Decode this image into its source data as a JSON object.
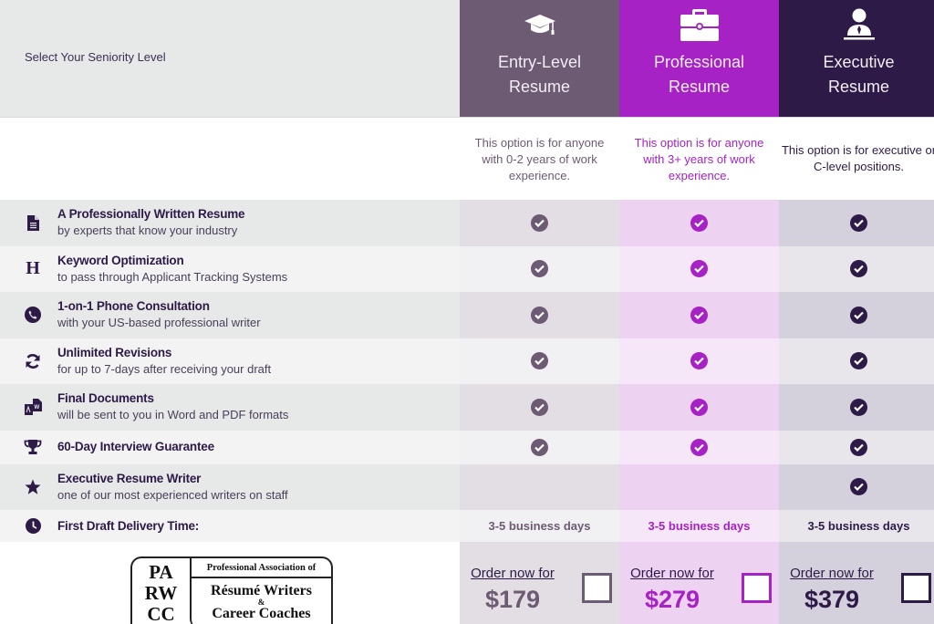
{
  "header": {
    "label": "Select Your Seniority Level"
  },
  "columns": [
    {
      "key": "entry",
      "icon": "graduation-cap-icon",
      "title_line1": "Entry-Level",
      "title_line2": "Resume",
      "description": "This option is for anyone with 0-2 years of work experience.",
      "color": "#6d5a73",
      "order_label": "Order now for",
      "price": "$179",
      "delivery": "3-5 business days"
    },
    {
      "key": "pro",
      "icon": "briefcase-icon",
      "title_line1": "Professional",
      "title_line2": "Resume",
      "description": "This option is for anyone with 3+ years of work experience.",
      "color": "#a622c4",
      "order_label": "Order now for",
      "price": "$279",
      "delivery": "3-5 business days"
    },
    {
      "key": "exec",
      "icon": "executive-user-icon",
      "title_line1": "Executive",
      "title_line2": "Resume",
      "description": "This option is for executive or C-level positions.",
      "color": "#2e1a47",
      "order_label": "Order now for",
      "price": "$379",
      "delivery": "3-5 business days"
    }
  ],
  "features": [
    {
      "icon": "document-icon",
      "title": "A Professionally Written Resume",
      "subtitle": "by experts that know your industry",
      "included": [
        true,
        true,
        true
      ]
    },
    {
      "icon": "heading-icon",
      "title": "Keyword Optimization",
      "subtitle": "to pass through Applicant Tracking Systems",
      "included": [
        true,
        true,
        true
      ]
    },
    {
      "icon": "phone-icon",
      "title": "1-on-1 Phone Consultation",
      "subtitle": "with your US-based professional writer",
      "included": [
        true,
        true,
        true
      ]
    },
    {
      "icon": "refresh-icon",
      "title": "Unlimited Revisions",
      "subtitle": "for up to 7-days after receiving your draft",
      "included": [
        true,
        true,
        true
      ]
    },
    {
      "icon": "file-formats-icon",
      "title": "Final Documents",
      "subtitle": "will be sent to you in Word and PDF formats",
      "included": [
        true,
        true,
        true
      ]
    },
    {
      "icon": "trophy-icon",
      "title": "60-Day Interview Guarantee",
      "subtitle": "",
      "included": [
        true,
        true,
        true
      ]
    },
    {
      "icon": "star-icon",
      "title": "Executive Resume Writer",
      "subtitle": "one of our most experienced writers on staff",
      "included": [
        false,
        false,
        true
      ]
    }
  ],
  "delivery_row": {
    "icon": "clock-icon",
    "title": "First Draft Delivery Time:"
  },
  "logo": {
    "left_lines": [
      "PA",
      "RW",
      "CC"
    ],
    "top_text": "Professional Association of",
    "line1": "Résumé Writers",
    "amp": "&",
    "line2": "Career Coaches"
  }
}
